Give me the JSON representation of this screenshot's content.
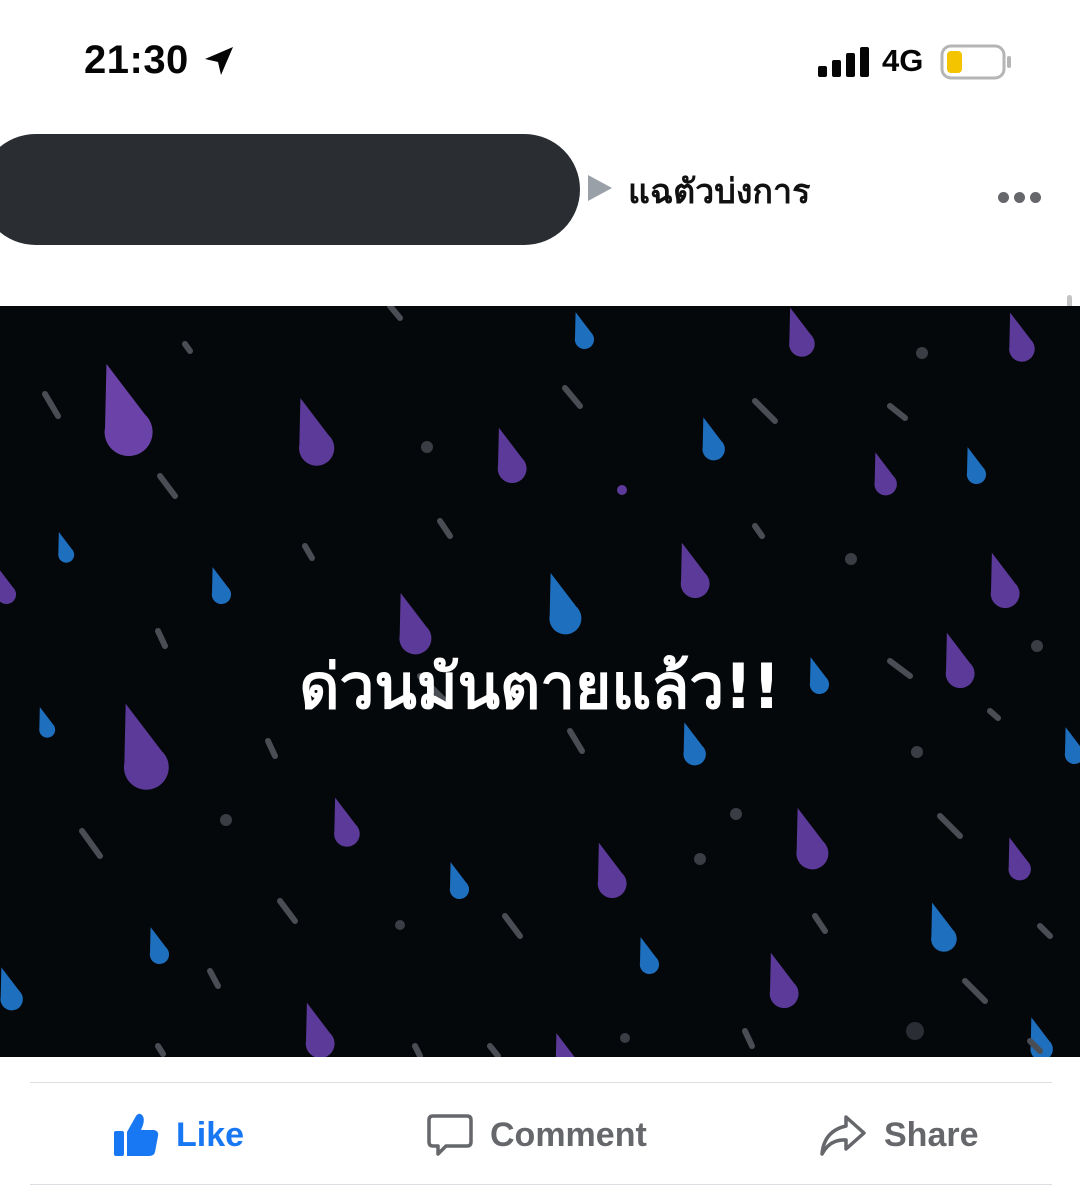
{
  "status_bar": {
    "time": "21:30",
    "network": "4G",
    "icons": [
      "location-arrow-icon",
      "cellular-signal-icon",
      "battery-low-icon"
    ],
    "battery_color": "#f5c400"
  },
  "post": {
    "page_name": "แฉตัวบ่งการ",
    "image_text": "ด่วนมันตายแล้ว!!",
    "image_background": "#05080b"
  },
  "actions": {
    "like": {
      "label": "Like",
      "icon": "thumbs-up-icon",
      "color": "#1877f2"
    },
    "comment": {
      "label": "Comment",
      "icon": "comment-bubble-icon",
      "color": "#65676b"
    },
    "share": {
      "label": "Share",
      "icon": "share-arrow-icon",
      "color": "#65676b"
    }
  }
}
